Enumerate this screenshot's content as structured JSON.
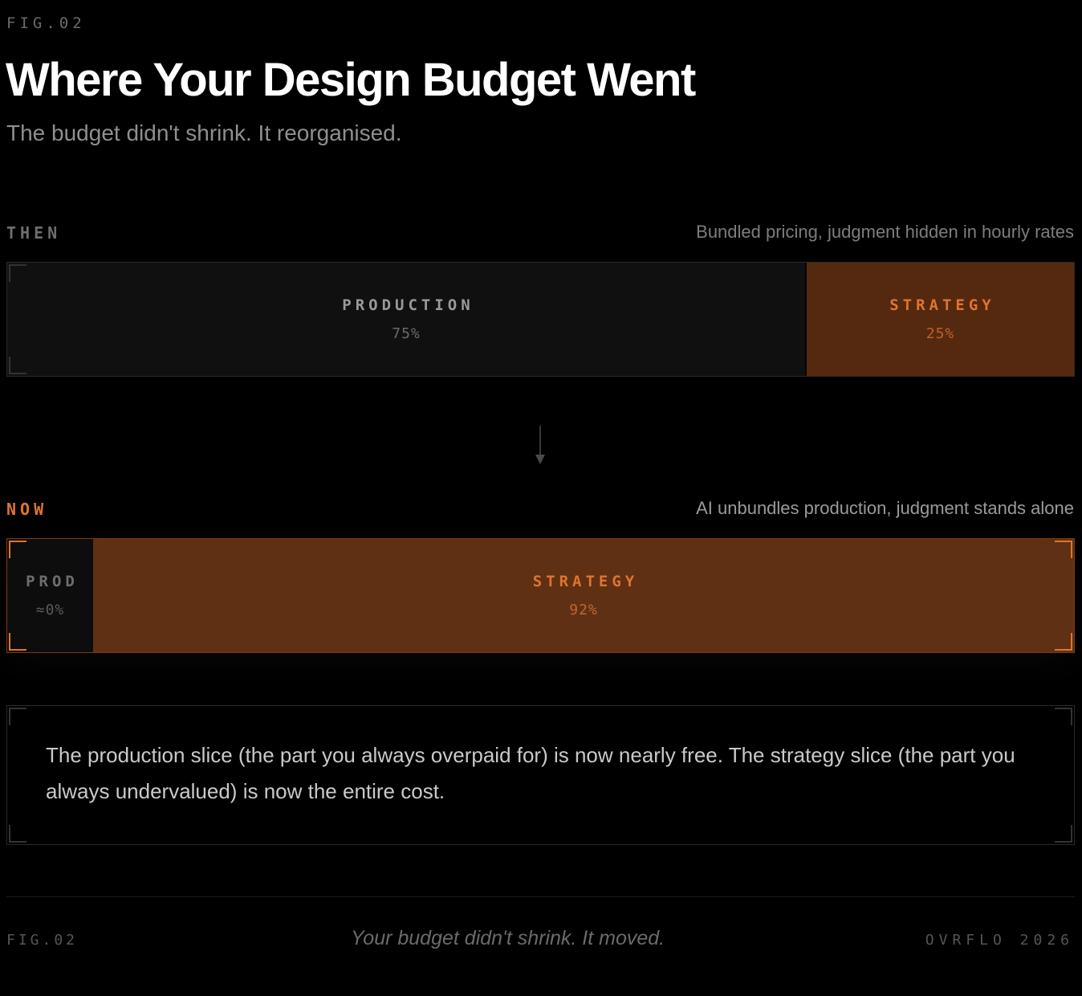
{
  "header": {
    "fig": "FIG.02",
    "title": "Where Your Design Budget Went",
    "subtitle": "The budget didn't shrink. It reorganised."
  },
  "chart_data": {
    "type": "bar",
    "orientation": "horizontal-stacked",
    "unit": "%",
    "bars": [
      {
        "label": "THEN",
        "note": "Bundled pricing, judgment hidden in hourly rates",
        "segments": [
          {
            "name": "PRODUCTION",
            "value": 75,
            "display": "75%"
          },
          {
            "name": "STRATEGY",
            "value": 25,
            "display": "25%"
          }
        ]
      },
      {
        "label": "NOW",
        "note": "AI unbundles production, judgment stands alone",
        "segments": [
          {
            "name": "PROD",
            "value": 8,
            "display": "≈0%"
          },
          {
            "name": "STRATEGY",
            "value": 92,
            "display": "92%"
          }
        ]
      }
    ],
    "colors": {
      "production": "#101010",
      "strategy_then": "#55290f",
      "strategy_now": "#5f3014",
      "accent": "#e0742f"
    }
  },
  "note": {
    "text": "The production slice (the part you always overpaid for) is now nearly free. The strategy slice (the part you always undervalued) is now the entire cost."
  },
  "footer": {
    "left": "FIG.02",
    "center": "Your budget didn't shrink. It moved.",
    "right": "OVRFLO 2026"
  },
  "icons": {
    "arrow": "arrow-down-icon"
  }
}
